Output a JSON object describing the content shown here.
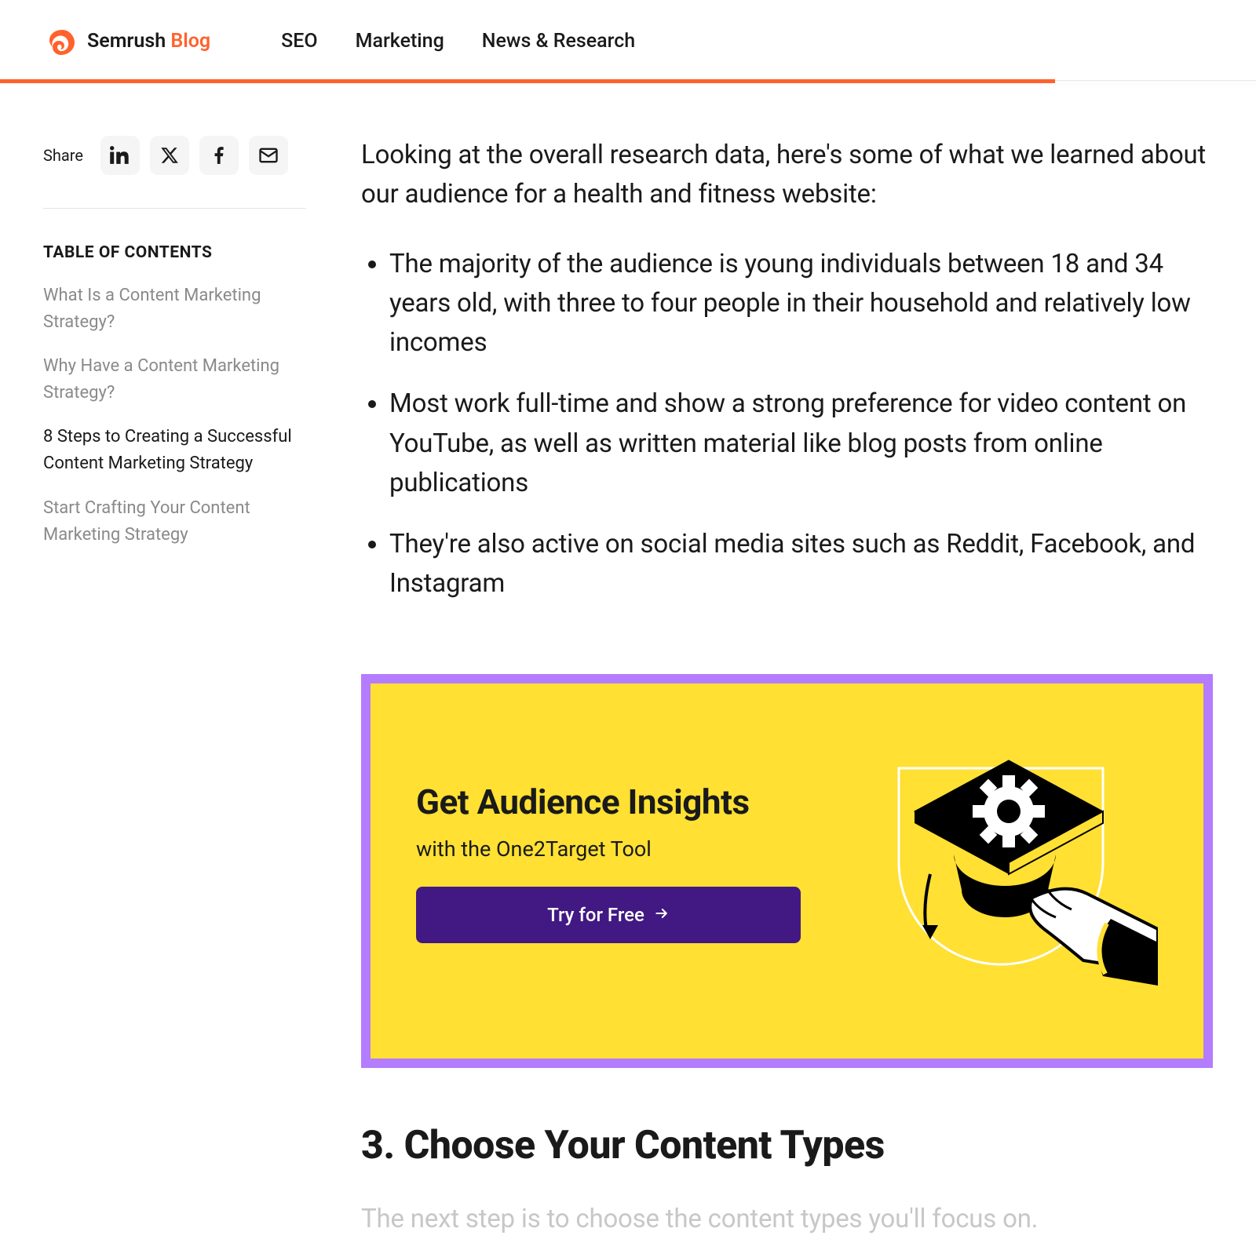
{
  "header": {
    "logo_semrush": "Semrush",
    "logo_blog": "Blog",
    "nav": [
      "SEO",
      "Marketing",
      "News & Research"
    ]
  },
  "sidebar": {
    "share_label": "Share",
    "toc_title": "TABLE OF CONTENTS",
    "toc_items": [
      {
        "label": "What Is a Content Marketing Strategy?",
        "active": false
      },
      {
        "label": "Why Have a Content Marketing Strategy?",
        "active": false
      },
      {
        "label": "8 Steps to Creating a Successful Content Marketing Strategy",
        "active": true
      },
      {
        "label": "Start Crafting Your Content Marketing Strategy",
        "active": false
      }
    ]
  },
  "article": {
    "intro": "Looking at the overall research data, here's some of what we learned about our audience for a health and fitness website:",
    "bullets": [
      "The majority of the audience is young individuals between 18 and 34 years old, with three to four people in their household and relatively low incomes",
      "Most work full-time and show a strong preference for video content on YouTube, as well as written material like blog posts from online publications",
      "They're also active on social media sites such as Reddit, Facebook, and Instagram"
    ],
    "promo": {
      "title": "Get Audience Insights",
      "subtitle": "with the One2Target Tool",
      "cta": "Try for Free"
    },
    "next_heading": "3. Choose Your Content Types",
    "next_para": "The next step is to choose the content types you'll focus on."
  }
}
